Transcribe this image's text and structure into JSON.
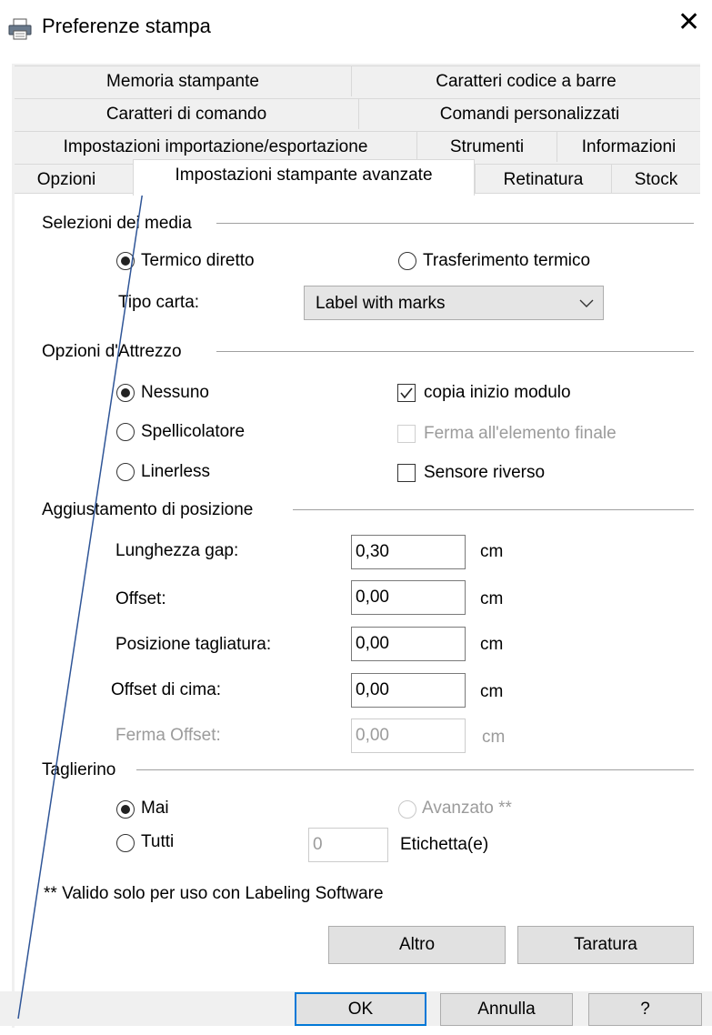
{
  "window": {
    "title": "Preferenze stampa"
  },
  "tabs": {
    "row1": [
      "Memoria stampante",
      "Caratteri codice a barre"
    ],
    "row2": [
      "Caratteri di comando",
      "Comandi personalizzati"
    ],
    "row3": [
      "Impostazioni importazione/esportazione",
      "Strumenti",
      "Informazioni"
    ],
    "row4": [
      "Opzioni",
      "Impostazioni stampante avanzate",
      "Retinatura",
      "Stock"
    ]
  },
  "media": {
    "group": "Selezioni dei media",
    "direct_thermal": "Termico diretto",
    "thermal_transfer": "Trasferimento termico",
    "paper_type_label": "Tipo carta:",
    "paper_type_value": "Label with marks"
  },
  "tooling": {
    "group": "Opzioni d'Attrezzo",
    "none": "Nessuno",
    "peeler": "Spellicolatore",
    "linerless": "Linerless",
    "copy_start": "copia inizio modulo",
    "stop_last": "Ferma all'elemento finale",
    "reverse_sensor": "Sensore riverso"
  },
  "position": {
    "group": "Aggiustamento di posizione",
    "rows": [
      {
        "label": "Lunghezza gap:",
        "value": "0,30",
        "unit": "cm"
      },
      {
        "label": "Offset:",
        "value": "0,00",
        "unit": "cm"
      },
      {
        "label": "Posizione tagliatura:",
        "value": "0,00",
        "unit": "cm"
      },
      {
        "label": "Offset di cima:",
        "value": "0,00",
        "unit": "cm"
      },
      {
        "label": "Ferma Offset:",
        "value": "0,00",
        "unit": "cm"
      }
    ]
  },
  "cutter": {
    "group": "Taglierino",
    "never": "Mai",
    "advanced": "Avanzato **",
    "all": "Tutti",
    "count_value": "0",
    "labels": "Etichetta(e)"
  },
  "note": "** Valido solo per uso con Labeling Software",
  "buttons": {
    "more": "Altro",
    "calibrate": "Taratura",
    "ok": "OK",
    "cancel": "Annulla",
    "help": "?"
  }
}
